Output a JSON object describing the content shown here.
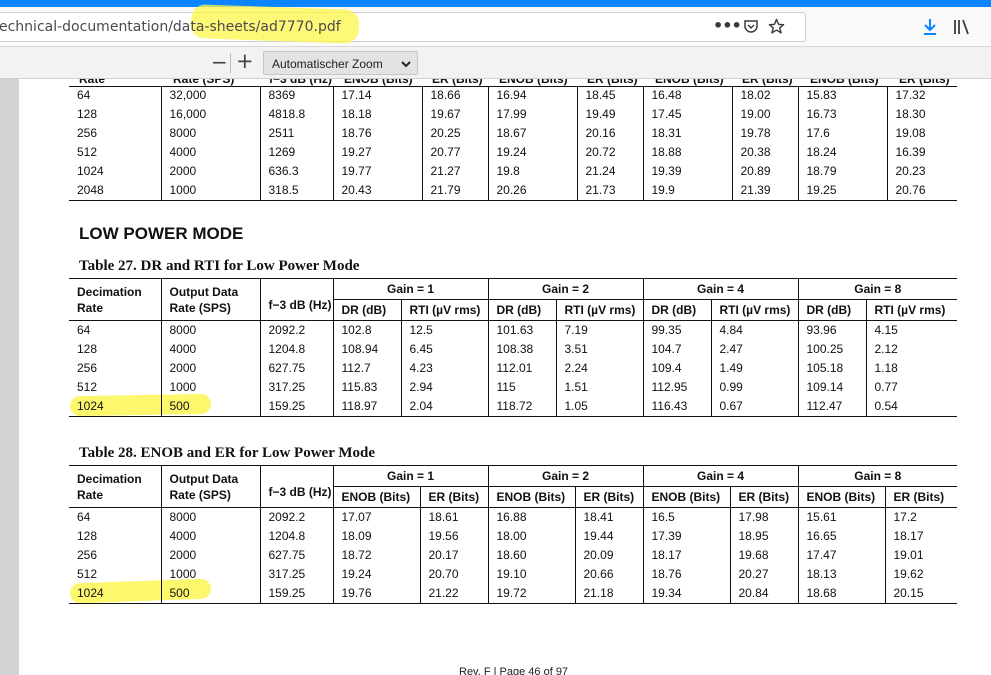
{
  "browser": {
    "url": "echnical-documentation/data-sheets/ad7770.pdf",
    "icons": [
      "more-icon",
      "pocket-icon",
      "star-icon",
      "download-icon",
      "library-icon"
    ]
  },
  "toolbar": {
    "zoom_out": "−",
    "zoom_in": "+",
    "zoom_value": "Automatischer Zoom"
  },
  "top_table": {
    "rows": [
      [
        "64",
        "32,000",
        "8369",
        "17.14",
        "18.66",
        "16.94",
        "18.45",
        "16.48",
        "18.02",
        "15.83",
        "17.32"
      ],
      [
        "128",
        "16,000",
        "4818.8",
        "18.18",
        "19.67",
        "17.99",
        "19.49",
        "17.45",
        "19.00",
        "16.73",
        "18.30"
      ],
      [
        "256",
        "8000",
        "2511",
        "18.76",
        "20.25",
        "18.67",
        "20.16",
        "18.31",
        "19.78",
        "17.6",
        "19.08"
      ],
      [
        "512",
        "4000",
        "1269",
        "19.27",
        "20.77",
        "19.24",
        "20.72",
        "18.88",
        "20.38",
        "18.24",
        "16.39"
      ],
      [
        "1024",
        "2000",
        "636.3",
        "19.77",
        "21.27",
        "19.8",
        "21.24",
        "19.39",
        "20.89",
        "18.79",
        "20.23"
      ],
      [
        "2048",
        "1000",
        "318.5",
        "20.43",
        "21.79",
        "20.26",
        "21.73",
        "19.9",
        "21.39",
        "19.25",
        "20.76"
      ]
    ]
  },
  "section_title": "LOW POWER MODE",
  "table27": {
    "caption": "Table 27. DR and RTI for Low Power Mode",
    "gains": [
      "Gain = 1",
      "Gain = 2",
      "Gain = 4",
      "Gain = 8"
    ],
    "head": {
      "dec1": "Decimation",
      "dec2": "Rate",
      "odr1": "Output Data",
      "odr2": "Rate (SPS)",
      "f3db": "f−3 dB (Hz)",
      "cols": [
        "DR (dB)",
        "RTI (µV rms)",
        "DR (dB)",
        "RTI (µV rms)",
        "DR (dB)",
        "RTI (µV rms)",
        "DR (dB)",
        "RTI (µV rms)"
      ]
    },
    "rows": [
      [
        "64",
        "8000",
        "2092.2",
        "102.8",
        "12.5",
        "101.63",
        "7.19",
        "99.35",
        "4.84",
        "93.96",
        "4.15"
      ],
      [
        "128",
        "4000",
        "1204.8",
        "108.94",
        "6.45",
        "108.38",
        "3.51",
        "104.7",
        "2.47",
        "100.25",
        "2.12"
      ],
      [
        "256",
        "2000",
        "627.75",
        "112.7",
        "4.23",
        "112.01",
        "2.24",
        "109.4",
        "1.49",
        "105.18",
        "1.18"
      ],
      [
        "512",
        "1000",
        "317.25",
        "115.83",
        "2.94",
        "115",
        "1.51",
        "112.95",
        "0.99",
        "109.14",
        "0.77"
      ],
      [
        "1024",
        "500",
        "159.25",
        "118.97",
        "2.04",
        "118.72",
        "1.05",
        "116.43",
        "0.67",
        "112.47",
        "0.54"
      ]
    ]
  },
  "table28": {
    "caption": "Table 28. ENOB and ER for Low Power Mode",
    "gains": [
      "Gain = 1",
      "Gain = 2",
      "Gain = 4",
      "Gain = 8"
    ],
    "head": {
      "dec1": "Decimation",
      "dec2": "Rate",
      "odr1": "Output Data",
      "odr2": "Rate (SPS)",
      "f3db": "f−3 dB (Hz)",
      "cols": [
        "ENOB (Bits)",
        "ER (Bits)",
        "ENOB (Bits)",
        "ER (Bits)",
        "ENOB (Bits)",
        "ER (Bits)",
        "ENOB (Bits)",
        "ER (Bits)"
      ]
    },
    "rows": [
      [
        "64",
        "8000",
        "2092.2",
        "17.07",
        "18.61",
        "16.88",
        "18.41",
        "16.5",
        "17.98",
        "15.61",
        "17.2"
      ],
      [
        "128",
        "4000",
        "1204.8",
        "18.09",
        "19.56",
        "18.00",
        "19.44",
        "17.39",
        "18.95",
        "16.65",
        "18.17"
      ],
      [
        "256",
        "2000",
        "627.75",
        "18.72",
        "20.17",
        "18.60",
        "20.09",
        "18.17",
        "19.68",
        "17.47",
        "19.01"
      ],
      [
        "512",
        "1000",
        "317.25",
        "19.24",
        "20.70",
        "19.10",
        "20.66",
        "18.76",
        "20.27",
        "18.13",
        "19.62"
      ],
      [
        "1024",
        "500",
        "159.25",
        "19.76",
        "21.22",
        "19.72",
        "21.18",
        "19.34",
        "20.84",
        "18.68",
        "20.15"
      ]
    ]
  },
  "footer": "Rev. F | Page 46 of 97"
}
